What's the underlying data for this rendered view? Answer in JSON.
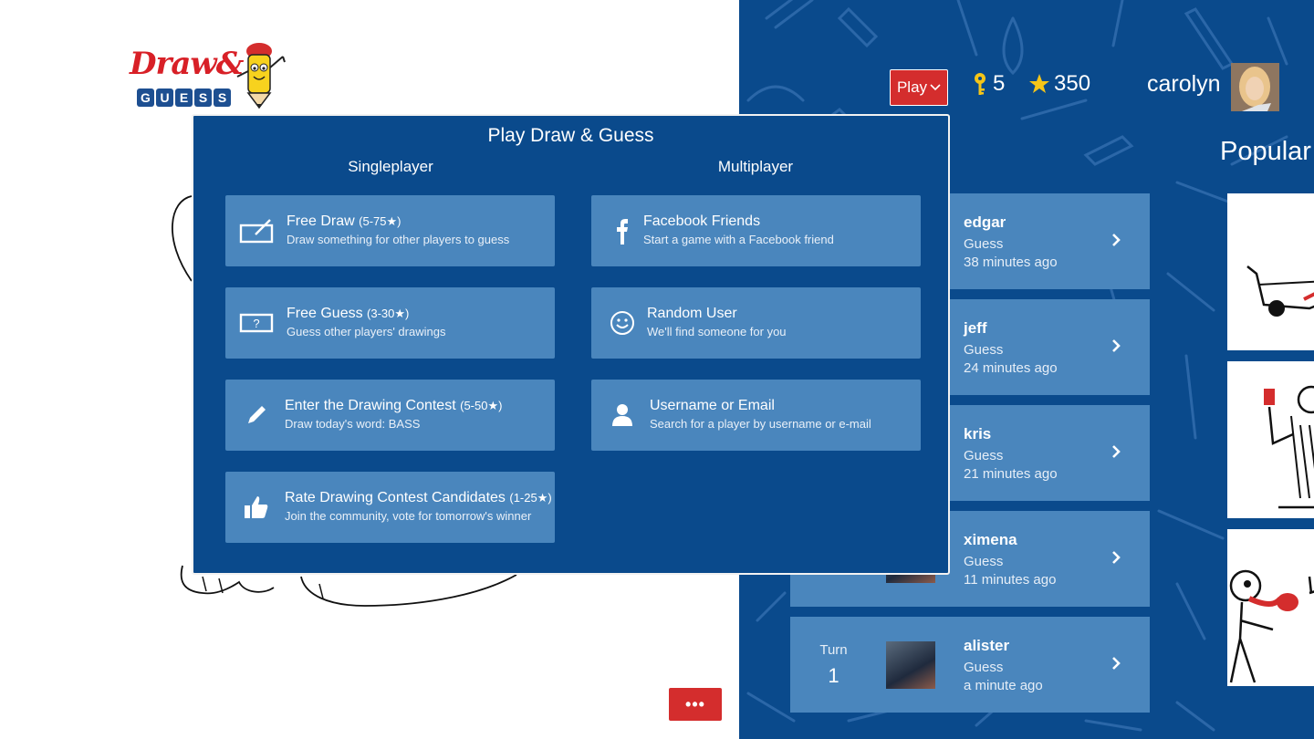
{
  "logo": {
    "text_top": "Draw&",
    "text_bottom": "GUESS"
  },
  "header": {
    "play_label": "Play",
    "keys": "5",
    "stars": "350",
    "username": "carolyn"
  },
  "popular": {
    "title": "Popular"
  },
  "games": [
    {
      "player": "edgar",
      "mode": "Guess",
      "time": "38 minutes ago"
    },
    {
      "player": "jeff",
      "mode": "Guess",
      "time": "24 minutes ago"
    },
    {
      "player": "kris",
      "mode": "Guess",
      "time": "21 minutes ago"
    },
    {
      "player": "ximena",
      "mode": "Guess",
      "time": "11 minutes ago"
    },
    {
      "player": "alister",
      "mode": "Guess",
      "time": "a minute ago",
      "turn_label": "Turn",
      "turn_number": "1"
    }
  ],
  "modal": {
    "title": "Play Draw & Guess",
    "singleplayer_title": "Singleplayer",
    "multiplayer_title": "Multiplayer",
    "singleplayer": [
      {
        "title": "Free Draw",
        "range": "(5-75★)",
        "subtitle": "Draw something for other players to guess",
        "icon": "draw-tablet-icon"
      },
      {
        "title": "Free Guess",
        "range": "(3-30★)",
        "subtitle": "Guess other players' drawings",
        "icon": "question-box-icon"
      },
      {
        "title": "Enter the Drawing Contest",
        "range": "(5-50★)",
        "subtitle": "Draw today's word: BASS",
        "icon": "pencil-icon"
      },
      {
        "title": "Rate Drawing Contest Candidates",
        "range": "(1-25★)",
        "subtitle": "Join the community, vote for tomorrow's winner",
        "icon": "thumbs-up-icon"
      }
    ],
    "multiplayer": [
      {
        "title": "Facebook Friends",
        "subtitle": "Start a game with a Facebook friend",
        "icon": "facebook-icon"
      },
      {
        "title": "Random User",
        "subtitle": "We'll find someone for you",
        "icon": "smiley-icon"
      },
      {
        "title": "Username or Email",
        "subtitle": "Search for a player by username or e-mail",
        "icon": "person-icon"
      }
    ]
  },
  "more_button": {
    "label": "•••"
  },
  "colors": {
    "blue_bg": "#0a4a8c",
    "card_blue": "#4a86bd",
    "red": "#d42d2d",
    "key_yellow": "#f5c518"
  }
}
